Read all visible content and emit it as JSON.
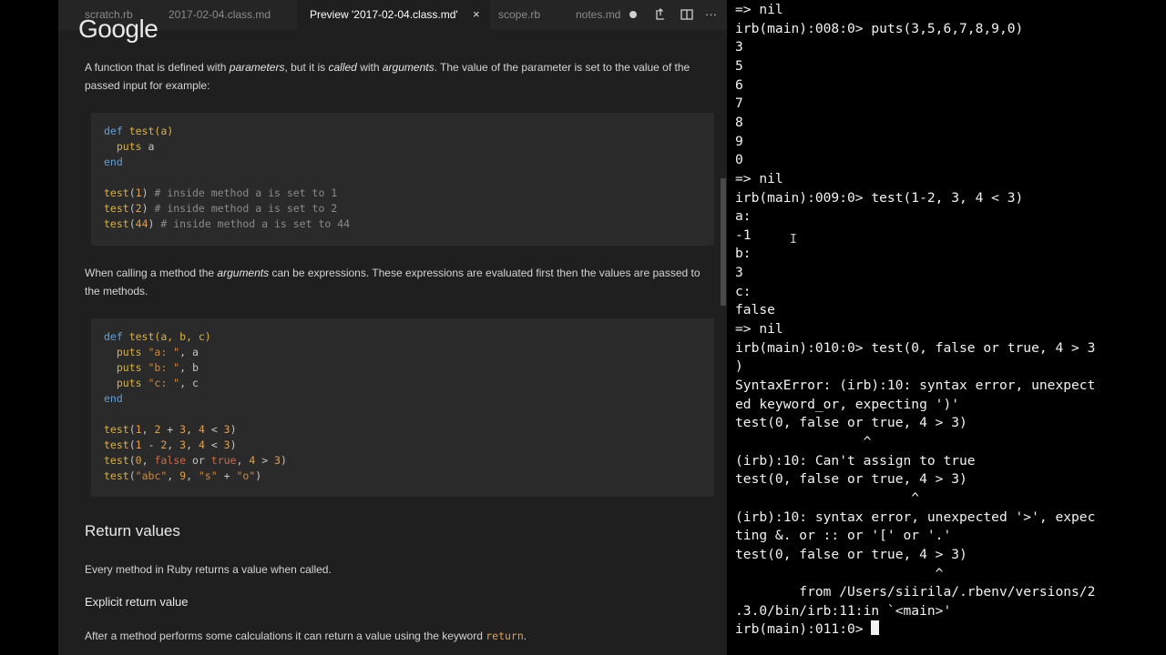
{
  "tabs": [
    {
      "label": "scratch.rb"
    },
    {
      "label": "2017-02-04.class.md"
    },
    {
      "label": "Preview '2017-02-04.class.md'"
    },
    {
      "label": "scope.rb"
    },
    {
      "label": "notes.md"
    }
  ],
  "tab_close_glyph": "×",
  "toolbar_more_glyph": "···",
  "overlay_logo": "Google",
  "preview": {
    "p1": {
      "t1": "A function that is defined with ",
      "e1": "parameters",
      "t2": ", but it is ",
      "e2": "called",
      "t3": " with ",
      "e3": "arguments",
      "t4": ". The value of the parameter is set to the value of the passed input for example:"
    },
    "p2": {
      "t1": "When calling a method the ",
      "e1": "arguments",
      "t2": " can be expressions. These expressions are evaluated first then the values are passed to the methods."
    },
    "heading_return": "Return values",
    "p3": "Every method in Ruby returns a value when called.",
    "heading_explicit": "Explicit return value",
    "p4": {
      "t1": "After a method performs some calculations it can return a value using the keyword ",
      "code": "return",
      "t2": "."
    }
  },
  "code1": {
    "l1": {
      "kw": "def",
      "fn": " test",
      "rest": "(a)"
    },
    "l2": {
      "ind": "  ",
      "kw": "puts",
      "rest": " a"
    },
    "l3": {
      "kw": "end"
    },
    "l5": {
      "fn": "test",
      "op": "(",
      "num": "1",
      "op2": ")",
      "cm": " # inside method a is set to 1"
    },
    "l6": {
      "fn": "test",
      "op": "(",
      "num": "2",
      "op2": ")",
      "cm": " # inside method a is set to 2"
    },
    "l7": {
      "fn": "test",
      "op": "(",
      "num": "44",
      "op2": ")",
      "cm": " # inside method a is set to 44"
    }
  },
  "code2": {
    "l1": {
      "kw": "def",
      "fn": " test",
      "rest": "(a, b, c)"
    },
    "l2": {
      "ind": "  ",
      "kw": "puts",
      "str": " \"a: \"",
      "rest": ", a"
    },
    "l3": {
      "ind": "  ",
      "kw": "puts",
      "str": " \"b: \"",
      "rest": ", b"
    },
    "l4": {
      "ind": "  ",
      "kw": "puts",
      "str": " \"c: \"",
      "rest": ", c"
    },
    "l5": {
      "kw": "end"
    },
    "l7": {
      "fn": "test",
      "a": "(",
      "n1": "1",
      "b": ", ",
      "n2": "2",
      "c": " + ",
      "n3": "3",
      "d": ", ",
      "n4": "4",
      "e": " < ",
      "n5": "3",
      "f": ")"
    },
    "l8": {
      "fn": "test",
      "a": "(",
      "n1": "1",
      "b": " - ",
      "n2": "2",
      "c": ", ",
      "n3": "3",
      "d": ", ",
      "n4": "4",
      "e": " < ",
      "n5": "3",
      "f": ")"
    },
    "l9": {
      "fn": "test",
      "a": "(",
      "n1": "0",
      "b": ", ",
      "k1": "false",
      "c": " or ",
      "k2": "true",
      "d": ", ",
      "n4": "4",
      "e": " > ",
      "n5": "3",
      "f": ")"
    },
    "l10": {
      "fn": "test",
      "a": "(",
      "s1": "\"abc\"",
      "b": ", ",
      "n2": "9",
      "c": ", ",
      "s2": "\"s\"",
      "d": " + ",
      "s3": "\"o\"",
      "f": ")"
    }
  },
  "terminal": {
    "lines": [
      "=> nil",
      "irb(main):008:0> puts(3,5,6,7,8,9,0)",
      "3",
      "5",
      "6",
      "7",
      "8",
      "9",
      "0",
      "=> nil",
      "irb(main):009:0> test(1-2, 3, 4 < 3)",
      "a: ",
      "-1",
      "b: ",
      "3",
      "c: ",
      "false",
      "=> nil",
      "irb(main):010:0> test(0, false or true, 4 > 3",
      ")",
      "SyntaxError: (irb):10: syntax error, unexpect",
      "ed keyword_or, expecting ')'",
      "test(0, false or true, 4 > 3)",
      "                ^",
      "(irb):10: Can't assign to true",
      "test(0, false or true, 4 > 3)",
      "                      ^",
      "(irb):10: syntax error, unexpected '>', expec",
      "ting &. or :: or '[' or '.'",
      "test(0, false or true, 4 > 3)",
      "                         ^",
      "        from /Users/siirila/.rbenv/versions/2",
      ".3.0/bin/irb:11:in `<main>'",
      "irb(main):011:0> "
    ]
  }
}
